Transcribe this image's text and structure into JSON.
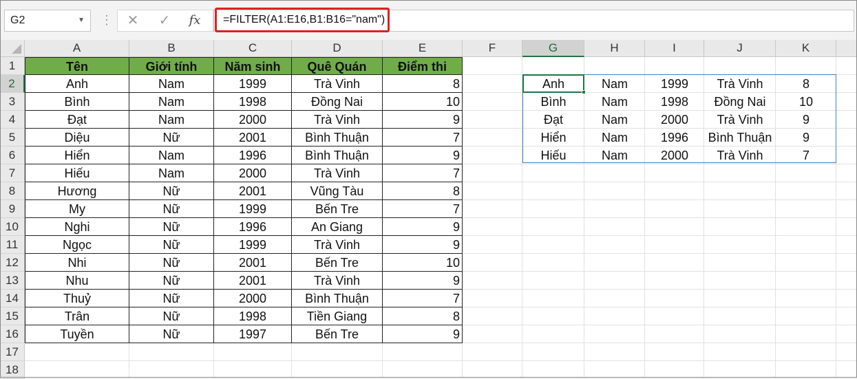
{
  "formula_bar": {
    "name_box": "G2",
    "cancel_icon": "✕",
    "enter_icon": "✓",
    "fx_label": "fx",
    "formula": "=FILTER(A1:E16,B1:B16=\"nam\")"
  },
  "colors": {
    "header_fill": "#70ad47",
    "selection": "#217346",
    "spill_border": "#3d7ec9",
    "formula_highlight": "#e02020"
  },
  "columns": [
    "A",
    "B",
    "C",
    "D",
    "E",
    "F",
    "G",
    "H",
    "I",
    "J",
    "K"
  ],
  "rows": [
    "1",
    "2",
    "3",
    "4",
    "5",
    "6",
    "7",
    "8",
    "9",
    "10",
    "11",
    "12",
    "13",
    "14",
    "15",
    "16",
    "17",
    "18"
  ],
  "selected_cell": "G2",
  "table": {
    "headers": [
      "Tên",
      "Giới tính",
      "Năm sinh",
      "Quê Quán",
      "Điểm thi"
    ],
    "rows": [
      [
        "Anh",
        "Nam",
        "1999",
        "Trà Vinh",
        "8"
      ],
      [
        "Bình",
        "Nam",
        "1998",
        "Đồng Nai",
        "10"
      ],
      [
        "Đạt",
        "Nam",
        "2000",
        "Trà Vinh",
        "9"
      ],
      [
        "Diệu",
        "Nữ",
        "2001",
        "Bình Thuận",
        "7"
      ],
      [
        "Hiển",
        "Nam",
        "1996",
        "Bình Thuận",
        "9"
      ],
      [
        "Hiếu",
        "Nam",
        "2000",
        "Trà Vinh",
        "7"
      ],
      [
        "Hương",
        "Nữ",
        "2001",
        "Vũng Tàu",
        "8"
      ],
      [
        "My",
        "Nữ",
        "1999",
        "Bến Tre",
        "7"
      ],
      [
        "Nghi",
        "Nữ",
        "1996",
        "An Giang",
        "9"
      ],
      [
        "Ngọc",
        "Nữ",
        "1999",
        "Trà Vinh",
        "9"
      ],
      [
        "Nhi",
        "Nữ",
        "2001",
        "Bến Tre",
        "10"
      ],
      [
        "Nhu",
        "Nữ",
        "2001",
        "Trà Vinh",
        "9"
      ],
      [
        "Thuỷ",
        "Nữ",
        "2000",
        "Bình Thuận",
        "7"
      ],
      [
        "Trân",
        "Nữ",
        "1998",
        "Tiền Giang",
        "8"
      ],
      [
        "Tuyền",
        "Nữ",
        "1997",
        "Bến Tre",
        "9"
      ]
    ]
  },
  "result": {
    "rows": [
      [
        "Anh",
        "Nam",
        "1999",
        "Trà Vinh",
        "8"
      ],
      [
        "Bình",
        "Nam",
        "1998",
        "Đồng Nai",
        "10"
      ],
      [
        "Đạt",
        "Nam",
        "2000",
        "Trà Vinh",
        "9"
      ],
      [
        "Hiển",
        "Nam",
        "1996",
        "Bình Thuận",
        "9"
      ],
      [
        "Hiếu",
        "Nam",
        "2000",
        "Trà Vinh",
        "7"
      ]
    ]
  }
}
